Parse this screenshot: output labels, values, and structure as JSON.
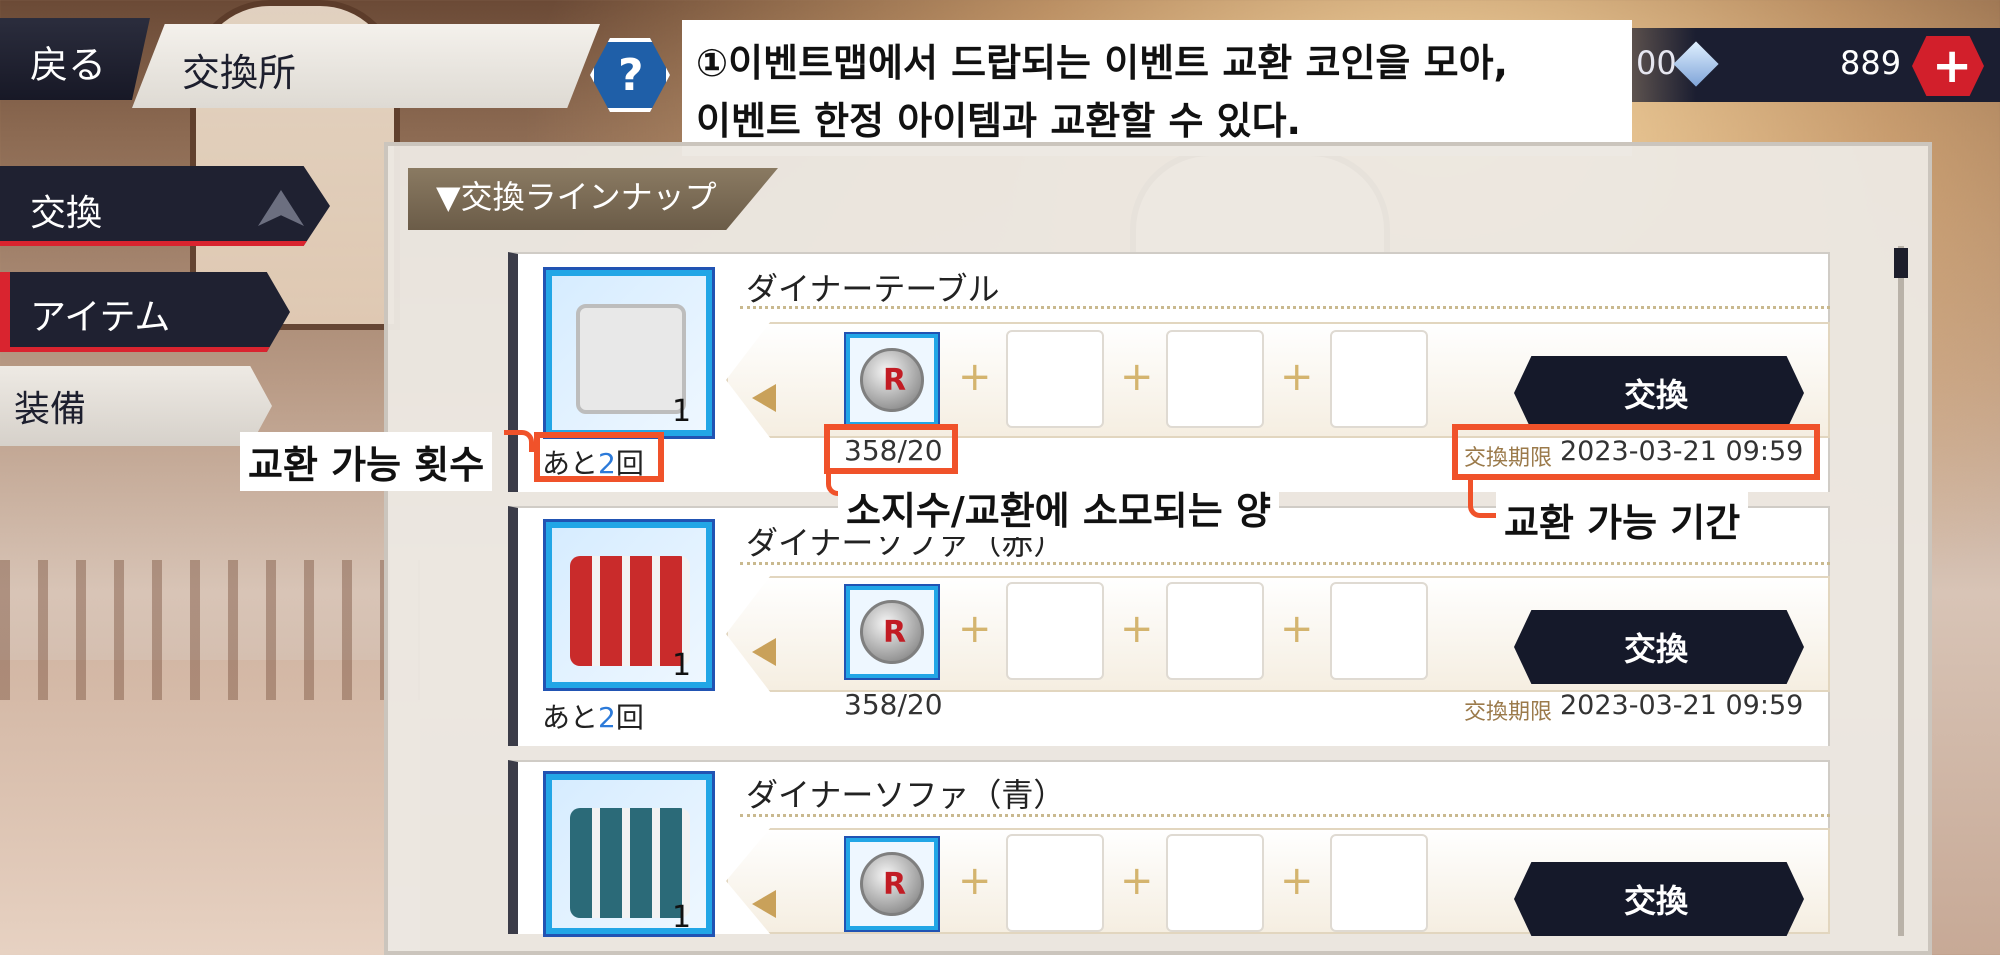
{
  "header": {
    "back_label": "戻る",
    "title": "交換所",
    "help_glyph": "?",
    "currency_left_value": "00",
    "currency_right_value": "889",
    "plus_glyph": "+"
  },
  "tooltip": {
    "line1": "①이벤트맵에서 드랍되는 이벤트 교환 코인을 모아,",
    "line2": "이벤트 한정 아이템과 교환할 수 있다."
  },
  "tabs": [
    {
      "label": "交換"
    },
    {
      "label": "アイテム"
    },
    {
      "label": "装備"
    }
  ],
  "lineup_label": "▼交換ラインナップ",
  "items": [
    {
      "name": "ダイナーテーブル",
      "qty": "1",
      "remain_prefix": "あと",
      "remain_count": "2",
      "remain_suffix": "回",
      "owned": "358/20",
      "limit_label": "交換期限",
      "limit_date": "2023-03-21 09:59",
      "button": "交換"
    },
    {
      "name": "ダイナーソファ（赤）",
      "qty": "1",
      "remain_prefix": "あと",
      "remain_count": "2",
      "remain_suffix": "回",
      "owned": "358/20",
      "limit_label": "交換期限",
      "limit_date": "2023-03-21 09:59",
      "button": "交換"
    },
    {
      "name": "ダイナーソファ（青）",
      "qty": "1",
      "button": "交換"
    }
  ],
  "coin_letter": "R",
  "slot_plus": "+",
  "annotations": {
    "count_label": "교환 가능 횟수",
    "cost_label": "소지수/교환에 소모되는 양",
    "period_label": "교환 가능 기간"
  },
  "colors": {
    "accent_red": "#d9242f",
    "annotation_orange": "#f0522a",
    "frame_blue": "#22a6e6",
    "navy": "#15192a"
  }
}
